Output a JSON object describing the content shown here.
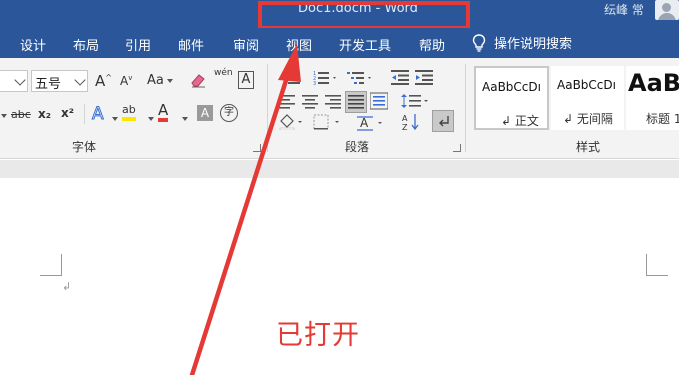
{
  "window": {
    "title": "Doc1.docm  -  Word",
    "user_name": "纭峰 常"
  },
  "tabs": [
    {
      "label": "设计"
    },
    {
      "label": "布局"
    },
    {
      "label": "引用"
    },
    {
      "label": "邮件"
    },
    {
      "label": "审阅"
    },
    {
      "label": "视图"
    },
    {
      "label": "开发工具"
    },
    {
      "label": "帮助"
    }
  ],
  "tell_me": {
    "label": "操作说明搜索"
  },
  "font_group": {
    "label": "字体",
    "font_size": "五号",
    "grow_label": "A",
    "shrink_label": "A",
    "case_label": "Aa",
    "strike_label": "abc",
    "sub_label": "x₂",
    "sup_label": "x²",
    "phonetic_label": "wén",
    "border_label": "A",
    "effects_label": "A",
    "highlight_label": "ab",
    "font_color_label": "A",
    "shading_label": "A",
    "enclose_label": "字",
    "clear_label": "A"
  },
  "paragraph_group": {
    "label": "段落"
  },
  "styles_group": {
    "label": "样式",
    "items": [
      {
        "sample": "AaBbCcDı",
        "name": "↲ 正文"
      },
      {
        "sample": "AaBbCcDı",
        "name": "↲ 无间隔"
      },
      {
        "sample": "AaB",
        "name": "标题 1"
      }
    ]
  },
  "document": {
    "paragraph_mark": "↲",
    "annotation": "已打开"
  },
  "colors": {
    "title_bar": "#2b579a",
    "ribbon": "#f3f3f3",
    "annotation_red": "#e53935"
  }
}
